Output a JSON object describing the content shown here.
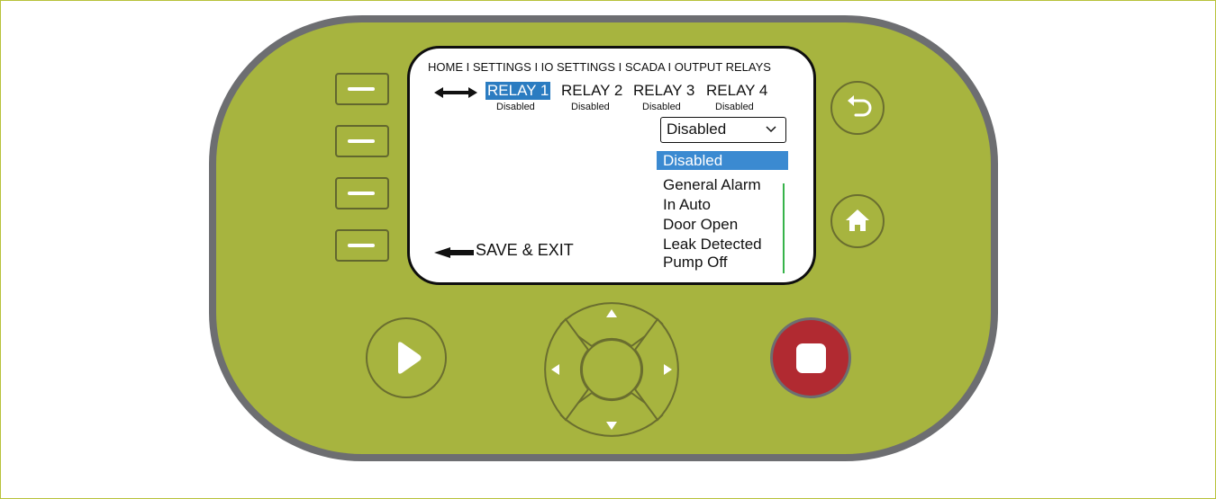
{
  "screen": {
    "breadcrumb": "HOME I SETTINGS I IO SETTINGS I SCADA I OUTPUT RELAYS",
    "relays": [
      {
        "label": "RELAY 1",
        "status": "Disabled",
        "active": true
      },
      {
        "label": "RELAY 2",
        "status": "Disabled",
        "active": false
      },
      {
        "label": "RELAY 3",
        "status": "Disabled",
        "active": false
      },
      {
        "label": "RELAY 4",
        "status": "Disabled",
        "active": false
      }
    ],
    "select": {
      "value": "Disabled",
      "options": [
        "Disabled",
        "General Alarm",
        "In Auto",
        "Door Open",
        "Leak Detected",
        "Pump Off"
      ]
    },
    "save_exit": "SAVE & EXIT"
  },
  "icons": {
    "back": "back-arrow-icon",
    "home": "home-icon",
    "play": "play-icon",
    "stop": "stop-icon",
    "up": "arrow-up-icon",
    "down": "arrow-down-icon",
    "left": "arrow-left-icon",
    "right": "arrow-right-icon"
  },
  "colors": {
    "device_body": "#a7b43f",
    "device_border": "#6d6e71",
    "highlight": "#2b7cc1",
    "selected_option": "#3b8ad1",
    "stop_button": "#b12a31",
    "scrollbar": "#37b34a"
  }
}
